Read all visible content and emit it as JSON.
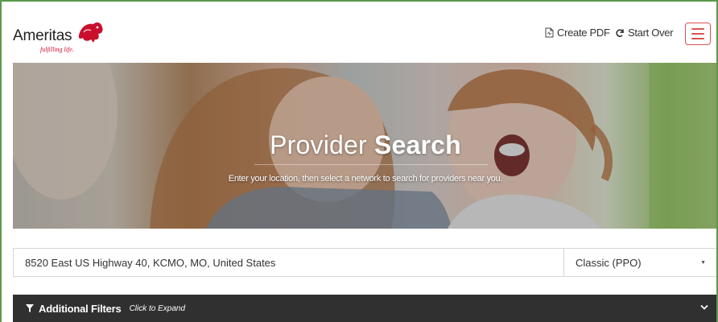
{
  "brand": {
    "name": "Ameritas",
    "tagline": "fulfilling life."
  },
  "header": {
    "create_pdf_label": "Create PDF",
    "start_over_label": "Start Over",
    "menu_icon": "hamburger-menu-icon"
  },
  "hero": {
    "title_regular": "Provider",
    "title_bold": "Search",
    "subtitle": "Enter your location, then select a network to search for providers near you."
  },
  "search": {
    "location_value": "8520 East US Highway 40, KCMO, MO, United States",
    "network_selected": "Classic (PPO)"
  },
  "filters": {
    "label": "Additional Filters",
    "hint": "Click to Expand"
  },
  "colors": {
    "brand_red": "#c8102e",
    "menu_red": "#d9534f",
    "filters_bar": "#303030"
  }
}
